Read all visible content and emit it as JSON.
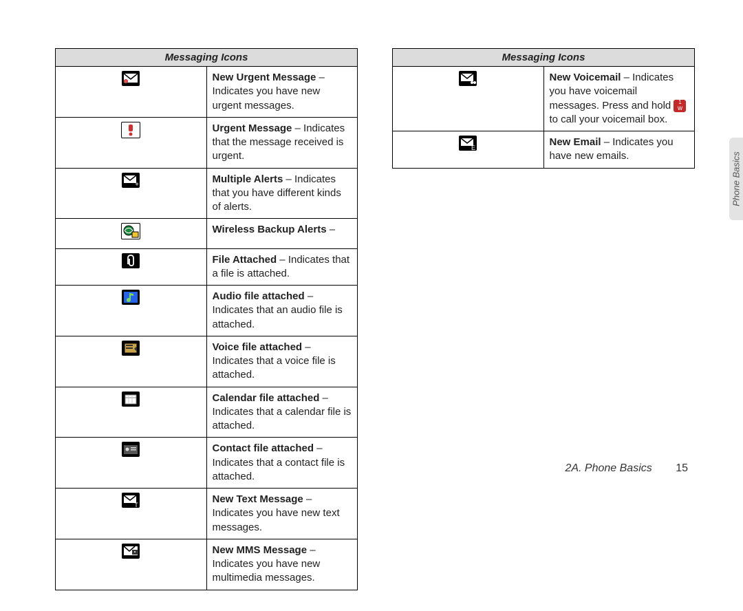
{
  "table_header": "Messaging Icons",
  "left_rows": [
    {
      "icon": "urgent-envelope-icon",
      "term": "New Urgent Message",
      "desc": " – Indicates you have new urgent messages."
    },
    {
      "icon": "exclamation-icon",
      "term": "Urgent Message",
      "desc": " – Indicates that the message received is urgent."
    },
    {
      "icon": "envelope-plus-icon",
      "term": "Multiple Alerts",
      "desc": " – Indicates that you have different kinds of alerts."
    },
    {
      "icon": "globe-backup-icon",
      "term": "Wireless Backup Alerts",
      "desc": " –"
    },
    {
      "icon": "paperclip-icon",
      "term": "File Attached",
      "desc": " – Indicates that a file is attached."
    },
    {
      "icon": "music-note-icon",
      "term": "Audio file attached",
      "desc": " – Indicates that an audio file is attached."
    },
    {
      "icon": "voice-file-icon",
      "term": "Voice file attached",
      "desc": " – Indicates that a voice file is attached."
    },
    {
      "icon": "calendar-icon",
      "term": "Calendar file attached",
      "desc": " – Indicates that a calendar file is attached."
    },
    {
      "icon": "contact-card-icon",
      "term": "Contact file attached",
      "desc": " – Indicates that a contact file is attached."
    },
    {
      "icon": "envelope-t-icon",
      "term": "New Text Message",
      "desc": " – Indicates you have new text messages."
    },
    {
      "icon": "envelope-photo-icon",
      "term": "New MMS Message",
      "desc": " – Indicates you have new multimedia messages."
    }
  ],
  "right_rows": [
    {
      "icon": "envelope-voicemail-icon",
      "term": "New Voicemail",
      "desc_pre": " – Indicates you have voicemail messages. Press and hold ",
      "key_top": "1",
      "key_bot": "w",
      "desc_post": " to call your voicemail box."
    },
    {
      "icon": "envelope-e-icon",
      "term": "New Email",
      "desc": " – Indicates you have new emails."
    }
  ],
  "side_tab": "Phone Basics",
  "footer_section": "2A. Phone Basics",
  "footer_page": "15"
}
